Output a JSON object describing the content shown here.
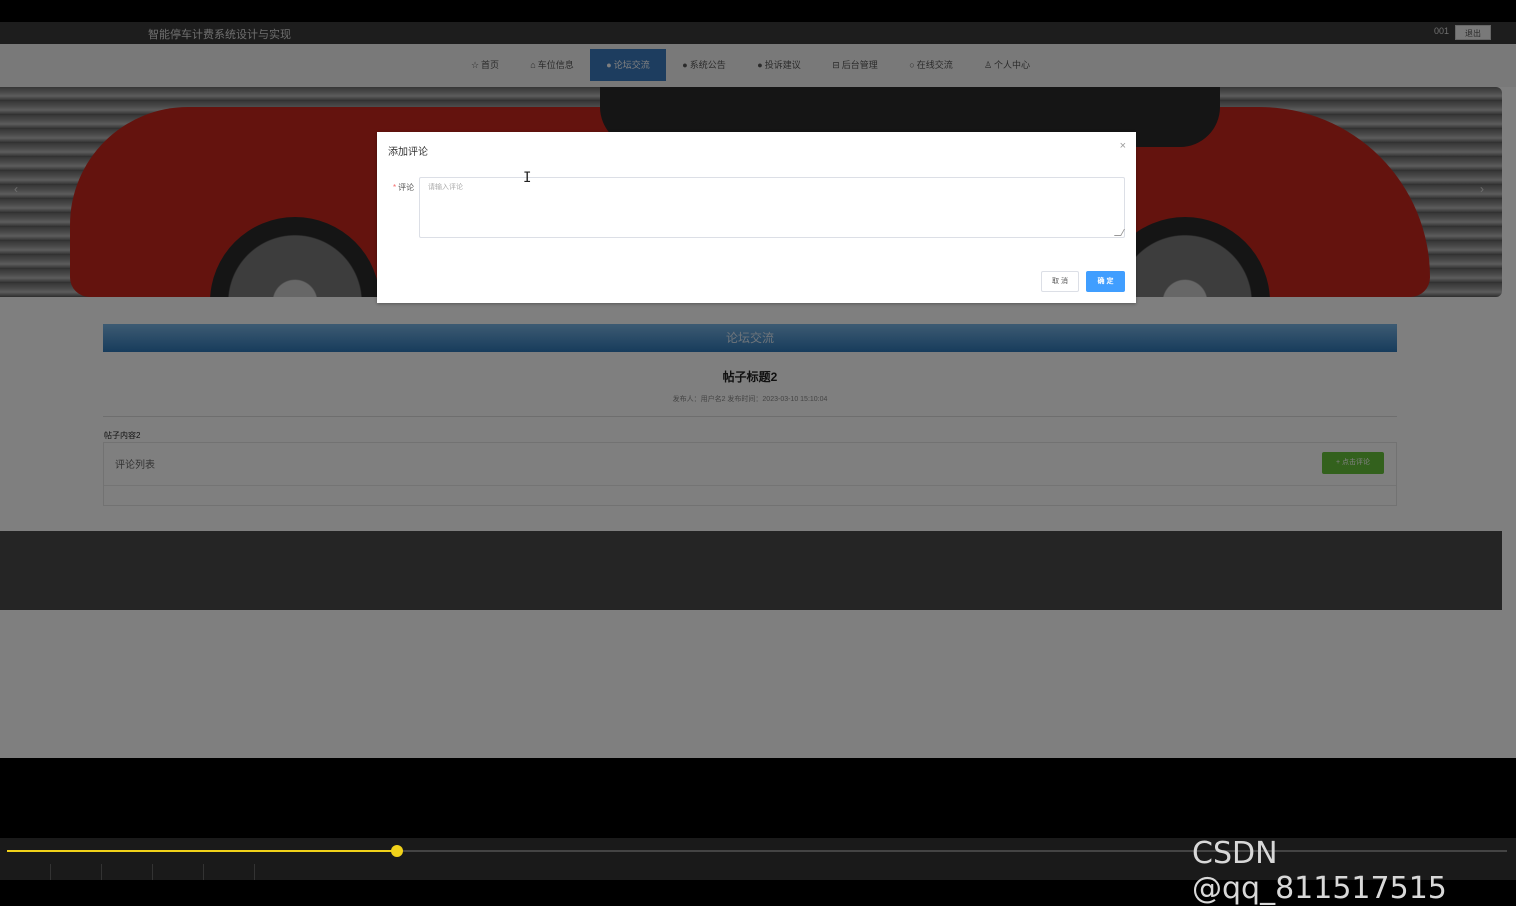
{
  "header": {
    "site_title": "智能停车计费系统设计与实现",
    "user_id": "001",
    "logout_label": "退出"
  },
  "nav": {
    "items": [
      {
        "icon": "☆",
        "label": "首页"
      },
      {
        "icon": "⌂",
        "label": "车位信息"
      },
      {
        "icon": "●",
        "label": "论坛交流"
      },
      {
        "icon": "●",
        "label": "系统公告"
      },
      {
        "icon": "●",
        "label": "投诉建议"
      },
      {
        "icon": "⊟",
        "label": "后台管理"
      },
      {
        "icon": "○",
        "label": "在线交流"
      },
      {
        "icon": "♙",
        "label": "个人中心"
      }
    ],
    "active_index": 2
  },
  "forum": {
    "header": "论坛交流",
    "post_title": "帖子标题2",
    "post_meta": "发布人：用户名2  发布时间：2023-03-10 15:10:04",
    "post_content": "帖子内容2",
    "comment_list_label": "评论列表",
    "add_comment_label": "+ 点击评论"
  },
  "dialog": {
    "title": "添加评论",
    "close_glyph": "×",
    "field_label": "评论",
    "required_mark": "*",
    "placeholder": "请输入评论",
    "cancel_label": "取 消",
    "ok_label": "确 定"
  },
  "player": {
    "progress": 0.26,
    "watermark": "CSDN @qq_811517515",
    "accent": "#f1d21a"
  }
}
